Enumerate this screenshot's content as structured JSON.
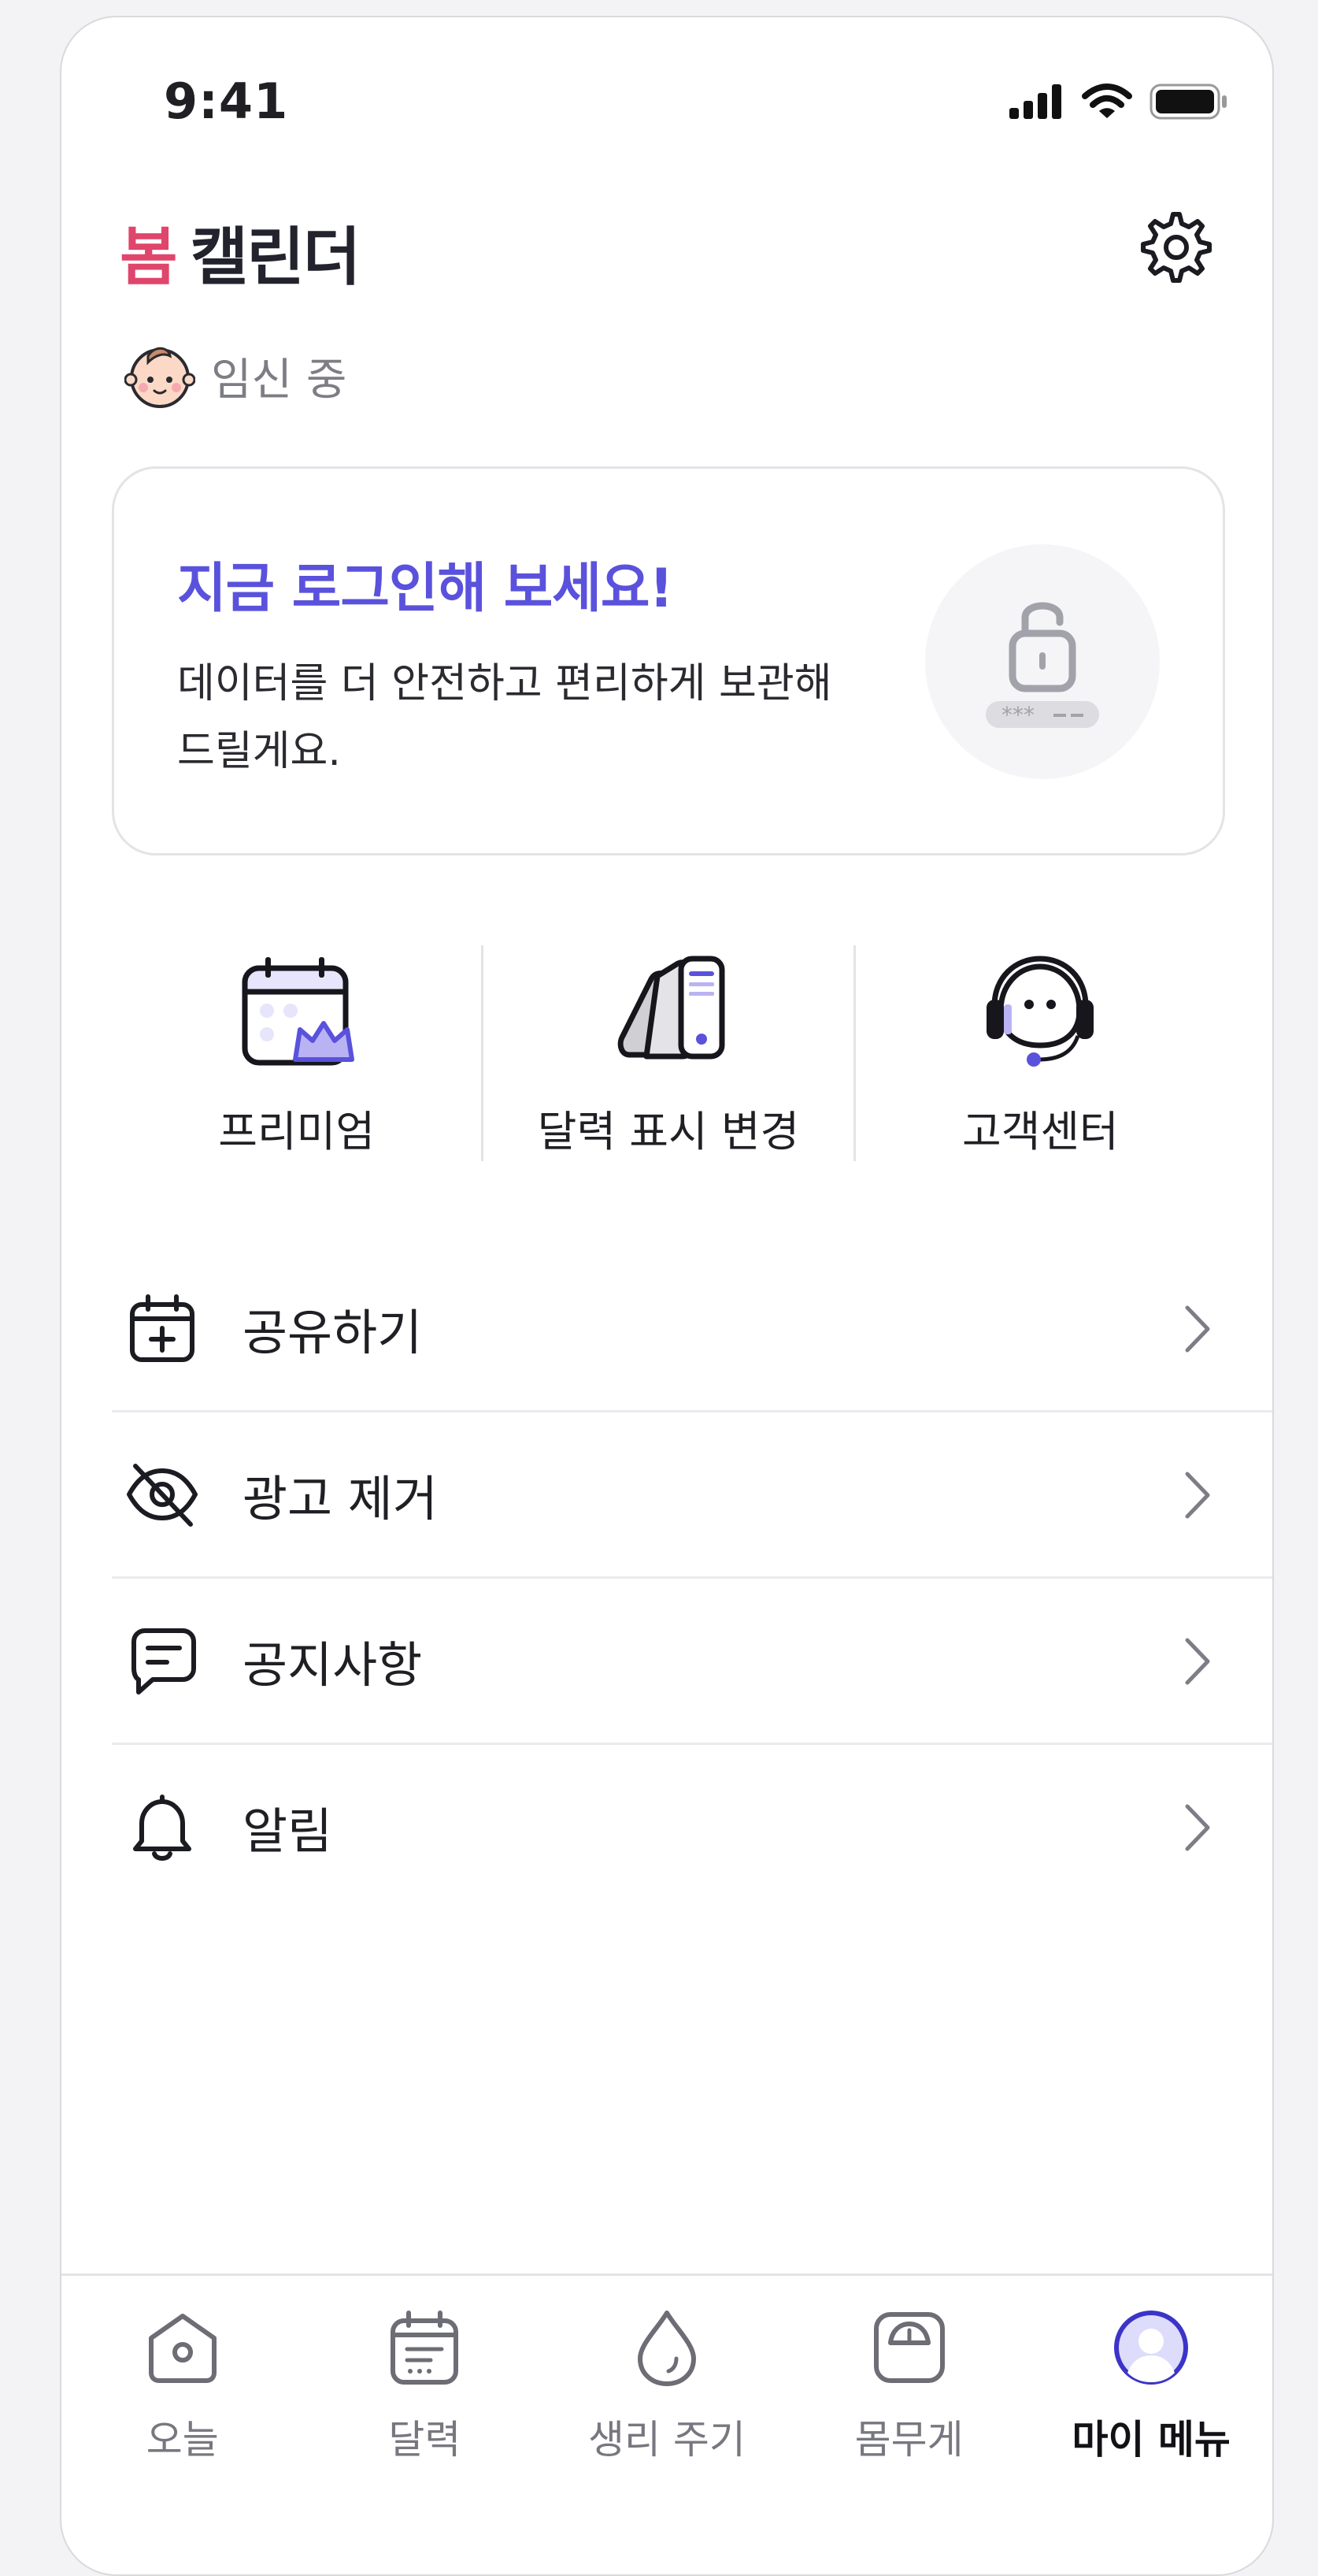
{
  "status_bar": {
    "time": "9:41"
  },
  "header": {
    "brand_mark": "봄",
    "brand_name": "캘린더",
    "status_label": "임신 중"
  },
  "login_card": {
    "title": "지금 로그인해 보세요!",
    "description": "데이터를 더 안전하고 편리하게 보관해 드릴게요."
  },
  "quick_menu": [
    {
      "label": "프리미엄",
      "icon": "calendar-crown-icon"
    },
    {
      "label": "달력 표시 변경",
      "icon": "color-swatch-icon"
    },
    {
      "label": "고객센터",
      "icon": "headset-icon"
    }
  ],
  "menu_list": [
    {
      "label": "공유하기",
      "icon": "calendar-plus-icon"
    },
    {
      "label": "광고 제거",
      "icon": "eye-off-icon"
    },
    {
      "label": "공지사항",
      "icon": "chat-notice-icon"
    },
    {
      "label": "알림",
      "icon": "bell-icon"
    }
  ],
  "bottom_nav": [
    {
      "label": "오늘",
      "icon": "home-icon"
    },
    {
      "label": "달력",
      "icon": "calendar-icon"
    },
    {
      "label": "생리 주기",
      "icon": "drop-icon"
    },
    {
      "label": "몸무게",
      "icon": "scale-icon"
    },
    {
      "label": "마이 메뉴",
      "icon": "profile-icon",
      "active": true
    }
  ],
  "colors": {
    "accent": "#5a52dc",
    "brand_pink": "#e0456b",
    "text": "#1f1f24",
    "muted": "#77777f",
    "divider": "#e3e3e8"
  }
}
